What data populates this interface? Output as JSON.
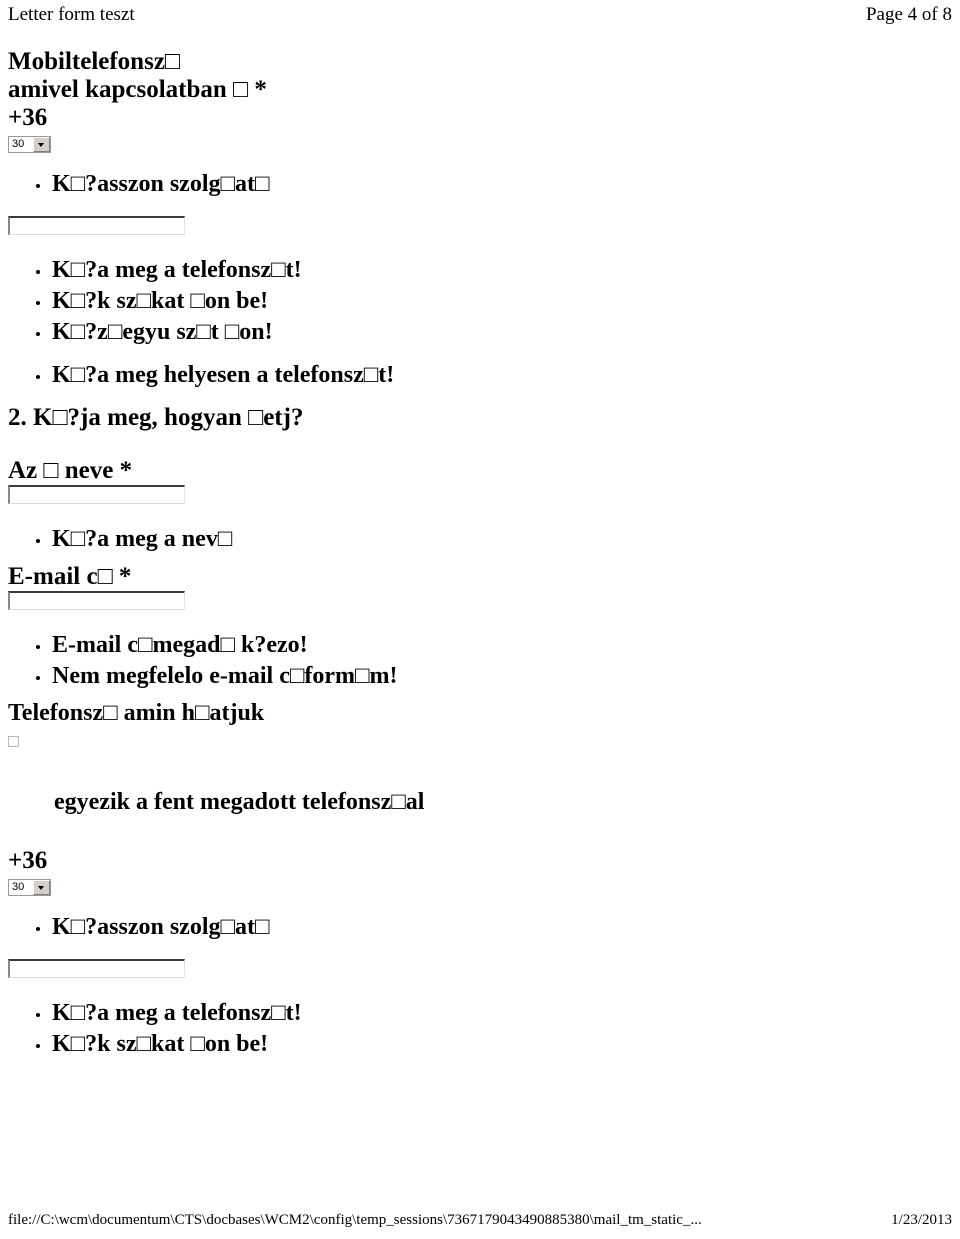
{
  "header": {
    "left_title": "Letter form teszt",
    "page_indicator": "Page 4 of 8"
  },
  "form": {
    "mobile_label_line1": "Mobiltelefonsz□",
    "mobile_label_line2": "amivel kapcsolatban □ *",
    "country_prefix_1": "+36",
    "area_select_1_value": "30",
    "hint_list_1": [
      "K□?asszon szolg□at□"
    ],
    "phone_input_1_value": "",
    "validation_list_1": [
      "K□?a meg a telefonsz□t!",
      "K□?k sz□kat □on be!",
      "K□?z□egyu sz□t □on!"
    ],
    "validation_list_1b": [
      "K□?a meg helyesen a telefonsz□t!"
    ],
    "section_2_heading": "2. K□?ja meg, hogyan □etj?",
    "name_label": "Az □ neve *",
    "name_input_value": "",
    "name_validation_list": [
      "K□?a meg a nev□"
    ],
    "email_label": "E-mail c□ *",
    "email_input_value": "",
    "email_validation_list": [
      "E-mail c□megad□ k?ezo!",
      "Nem megfelelo e-mail c□form□m!"
    ],
    "callback_label": "Telefonsz□ amin h□atjuk",
    "callback_checkbox_label": "egyezik a fent megadott telefonsz□al",
    "callback_checkbox_checked": false,
    "country_prefix_2": "+36",
    "area_select_2_value": "30",
    "hint_list_2": [
      "K□?asszon szolg□at□"
    ],
    "phone_input_2_value": "",
    "validation_list_2": [
      "K□?a meg a telefonsz□t!",
      "K□?k sz□kat □on be!"
    ]
  },
  "footer": {
    "file_path": "file://C:\\wcm\\documentum\\CTS\\docbases\\WCM2\\config\\temp_sessions\\7367179043490885380\\mail_tm_static_...",
    "date": "1/23/2013"
  },
  "icons": {
    "dropdown_arrow": "chevron-down-icon",
    "bullet": "bullet-icon",
    "checkbox": "checkbox-icon"
  },
  "colors": {
    "page_background": "#ffffff",
    "text": "#000000",
    "input_border_dark": "#3b3b3b",
    "input_border_light": "#e3e3e3",
    "select_button": "#d4d0c8",
    "checkbox_border": "#b8b8b8"
  }
}
